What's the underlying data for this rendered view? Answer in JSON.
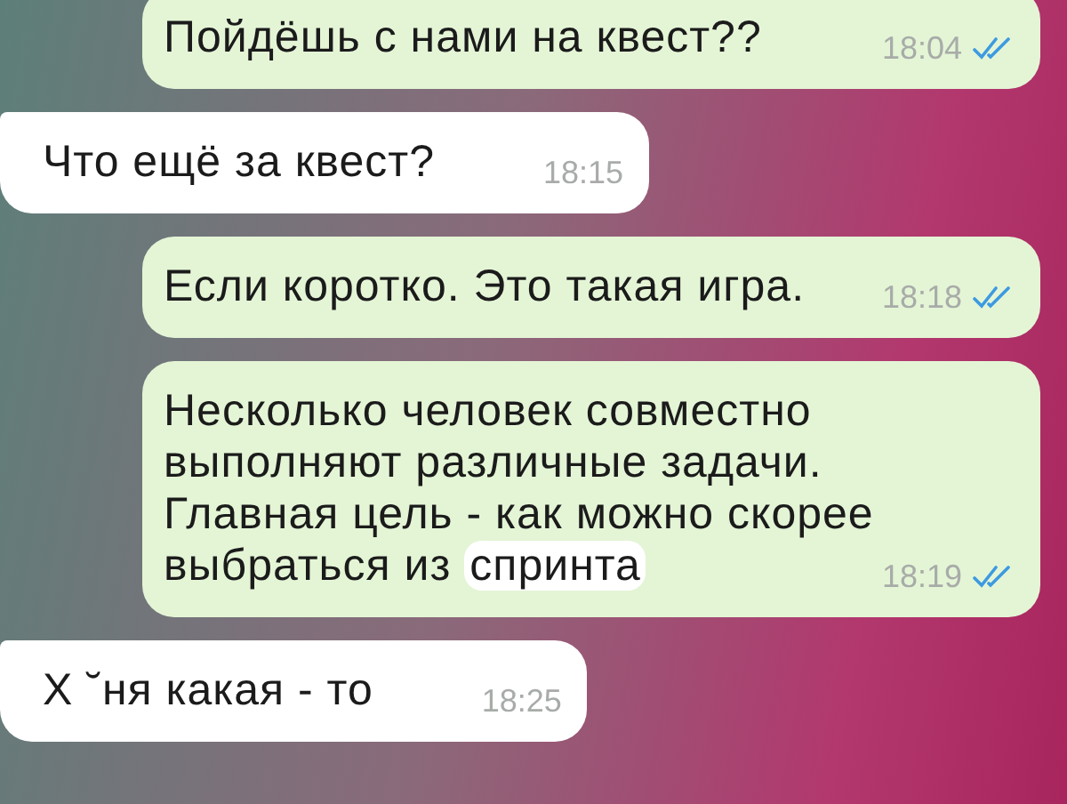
{
  "messages": [
    {
      "kind": "outgoing",
      "text": "Пойдёшь с нами на квест??",
      "time": "18:04",
      "read": true
    },
    {
      "kind": "incoming",
      "text": "Что ещё за квест?",
      "time": "18:15"
    },
    {
      "kind": "outgoing",
      "text": "Если коротко. Это такая игра.",
      "time": "18:18",
      "read": true
    },
    {
      "kind": "outgoing",
      "text": "Несколько человек совместно\nвыполняют различные задачи.\nГлавная цель - как можно скорее\nвыбраться из ",
      "highlight": "спринта",
      "time": "18:19",
      "read": true
    },
    {
      "kind": "incoming",
      "text": "Х ˘ня какая - то",
      "time": "18:25"
    }
  ]
}
